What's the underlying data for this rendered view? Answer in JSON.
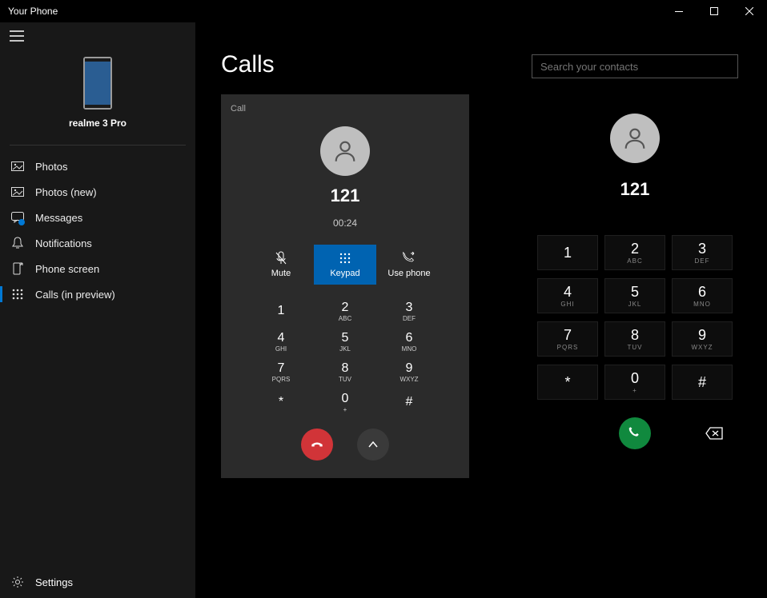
{
  "window": {
    "title": "Your Phone"
  },
  "sidebar": {
    "device_name": "realme 3 Pro",
    "items": [
      {
        "label": "Photos"
      },
      {
        "label": "Photos (new)"
      },
      {
        "label": "Messages"
      },
      {
        "label": "Notifications"
      },
      {
        "label": "Phone screen"
      },
      {
        "label": "Calls (in preview)"
      }
    ],
    "settings_label": "Settings"
  },
  "page": {
    "title": "Calls"
  },
  "call_panel": {
    "label": "Call",
    "number": "121",
    "timer": "00:24",
    "actions": {
      "mute": "Mute",
      "keypad": "Keypad",
      "use_phone": "Use phone"
    }
  },
  "keypad_keys": [
    {
      "d": "1",
      "s": ""
    },
    {
      "d": "2",
      "s": "ABC"
    },
    {
      "d": "3",
      "s": "DEF"
    },
    {
      "d": "4",
      "s": "GHI"
    },
    {
      "d": "5",
      "s": "JKL"
    },
    {
      "d": "6",
      "s": "MNO"
    },
    {
      "d": "7",
      "s": "PQRS"
    },
    {
      "d": "8",
      "s": "TUV"
    },
    {
      "d": "9",
      "s": "WXYZ"
    },
    {
      "d": "*",
      "s": ""
    },
    {
      "d": "0",
      "s": "+"
    },
    {
      "d": "#",
      "s": ""
    }
  ],
  "dialer": {
    "search_placeholder": "Search your contacts",
    "number": "121"
  }
}
